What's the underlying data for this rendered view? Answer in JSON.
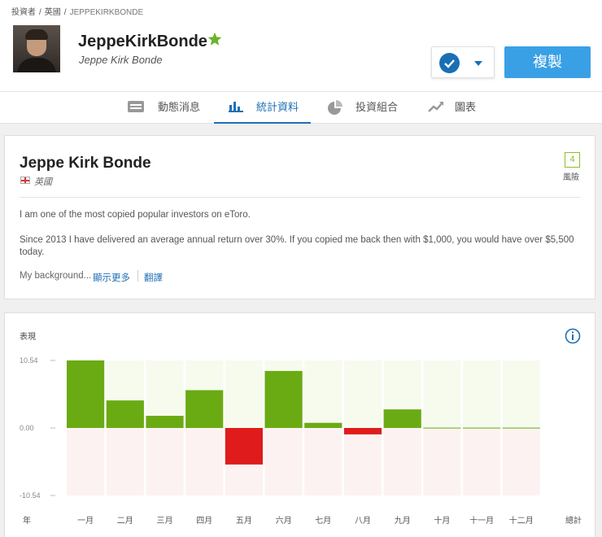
{
  "breadcrumb": {
    "investors": "投資者",
    "sep1": "/",
    "country": "英國",
    "sep2": "/",
    "current": "JEPPEKIRKBONDE"
  },
  "profile": {
    "username": "JeppeKirkBonde",
    "fullname": "Jeppe Kirk Bonde",
    "copy_label": "複製",
    "star_color": "#6bb42a",
    "accent": "#1a6fb4",
    "copy_color": "#3aa0e6"
  },
  "tabs": [
    {
      "label": "動態消息",
      "icon": "feed-icon"
    },
    {
      "label": "統計資料",
      "icon": "bar-chart-icon",
      "active": true
    },
    {
      "label": "投資組合",
      "icon": "pie-chart-icon"
    },
    {
      "label": "圖表",
      "icon": "line-chart-icon"
    }
  ],
  "about": {
    "name": "Jeppe Kirk Bonde",
    "country": "英國",
    "risk_score": "4",
    "risk_label": "風險",
    "bio_line1": "I am one of the most copied popular investors on eToro.",
    "bio_line2": "Since 2013 I have delivered an average annual return over 30%. If you copied me back then with $1,000, you would have over $5,500 today.",
    "background": "My background...",
    "show_more": "顯示更多",
    "translate": "翻譯"
  },
  "performance": {
    "label": "表現",
    "year_label": "年",
    "total_label": "總計"
  },
  "chart_data": {
    "type": "bar",
    "categories": [
      "一月",
      "二月",
      "三月",
      "四月",
      "五月",
      "六月",
      "七月",
      "八月",
      "九月",
      "十月",
      "十一月",
      "十二月"
    ],
    "values": [
      10.54,
      4.3,
      1.9,
      5.9,
      -5.7,
      8.9,
      0.8,
      -1.0,
      2.9,
      0.05,
      0.05,
      0.05
    ],
    "ytick_labels": [
      "10.54",
      "0.00",
      "-10.54"
    ],
    "ylim": [
      -10.54,
      10.54
    ],
    "positive_color": "#6aab13",
    "negative_color": "#e01b1b",
    "positive_bg": "#f6fbee",
    "negative_bg": "#fdf2f2"
  }
}
